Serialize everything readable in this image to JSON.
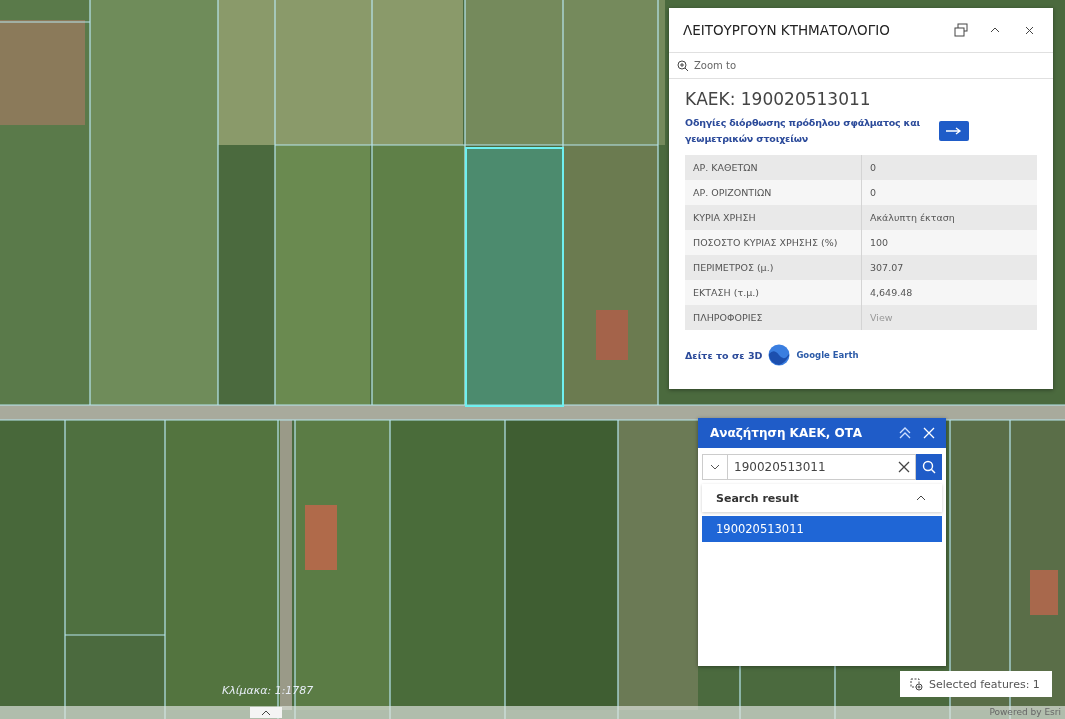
{
  "info_panel": {
    "title": "ΛΕΙΤΟΥΡΓΟΥΝ ΚΤΗΜΑΤΟΛΟΓΙΟ",
    "zoom_action": "Zoom to",
    "heading": "ΚΑΕΚ: 190020513011",
    "correction_link": "Οδηγίες διόρθωσης πρόδηλου σφάλματος και γεωμετρικών στοιχείων",
    "attributes": [
      {
        "label": "ΑΡ. ΚΑΘΕΤΩΝ",
        "value": "0",
        "kind": "text"
      },
      {
        "label": "ΑΡ. ΟΡΙΖΟΝΤΙΩΝ",
        "value": "0",
        "kind": "text"
      },
      {
        "label": "ΚΥΡΙΑ ΧΡΗΣΗ",
        "value": "Ακάλυπτη έκταση",
        "kind": "text"
      },
      {
        "label": "ΠΟΣΟΣΤΟ ΚΥΡΙΑΣ ΧΡΗΣΗΣ (%)",
        "value": "100",
        "kind": "text"
      },
      {
        "label": "ΠΕΡΙΜΕΤΡΟΣ (μ.)",
        "value": "307.07",
        "kind": "text"
      },
      {
        "label": "ΕΚΤΑΣΗ (τ.μ.)",
        "value": "4,649.48",
        "kind": "text"
      },
      {
        "label": "ΠΛΗΡΟΦΟΡΙΕΣ",
        "value": "View",
        "kind": "link"
      }
    ],
    "view_3d_link": "Δείτε το σε 3D",
    "google_earth_label": "Google Earth"
  },
  "search_widget": {
    "title": "Αναζήτηση ΚΑΕΚ, ΟΤΑ",
    "query": "190020513011",
    "results_heading": "Search result",
    "results": [
      {
        "label": "190020513011",
        "selected": true
      }
    ]
  },
  "map": {
    "scale_label": "Κλίμακα: 1:1787",
    "selected_features": "Selected features: 1",
    "attribution": "Powered by Esri"
  }
}
